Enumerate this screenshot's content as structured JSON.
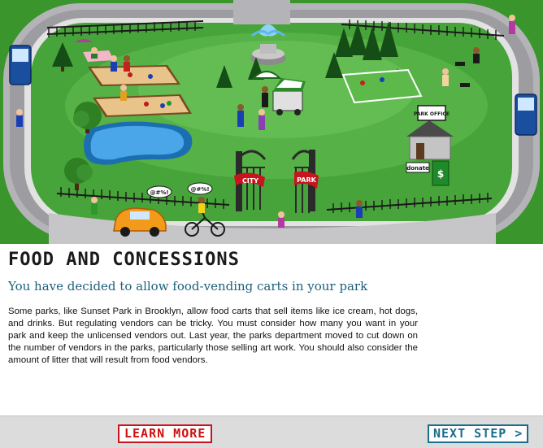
{
  "scene": {
    "gate_left_sign": "CITY",
    "gate_right_sign": "PARK",
    "park_office_sign": "PARK OFFICE",
    "donate_sign": "donate",
    "donation_box_symbol": "$",
    "swear_bubble_1": "@#%!",
    "swear_bubble_2": "@#%!"
  },
  "content": {
    "title": "FOOD AND CONCESSIONS",
    "subtitle": "You have decided to allow food-vending carts in your park",
    "body": "Some parks, like Sunset Park in Brooklyn, allow food carts that sell items like ice cream, hot dogs, and drinks. But regulating vendors can be tricky. You must consider how many you want in your park and keep the unlicensed vendors out. Last year, the parks department moved to cut down on the number of vendors in the parks, particularly those selling art work. You should also consider the amount of litter that will result from food vendors."
  },
  "footer": {
    "learn_more_label": "LEARN MORE",
    "next_step_label": "NEXT STEP >"
  },
  "colors": {
    "grass": "#3f9a2e",
    "road": "#a9a9ad",
    "pond": "#3b8fd0",
    "title_text": "#1a1a1a",
    "subtitle_text": "#1b5f7c",
    "learn_more": "#d01010",
    "next_step": "#1a6e8c",
    "footer_bg": "#dcdcdc"
  }
}
